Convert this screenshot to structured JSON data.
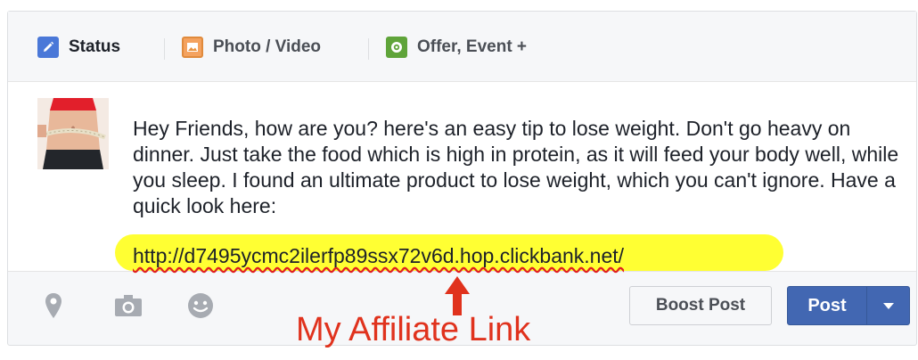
{
  "tabs": [
    {
      "label": "Status",
      "icon": "pencil-icon"
    },
    {
      "label": "Photo / Video",
      "icon": "photo-icon"
    },
    {
      "label": "Offer, Event +",
      "icon": "offer-icon"
    }
  ],
  "post": {
    "text": "Hey Friends, how are you? here's an easy tip to lose weight. Don't go heavy on dinner. Just take the food which is high in protein, as it will feed your body well, while you sleep. I found an ultimate product to lose weight, which you can't ignore. Have a quick look here:",
    "link": "http://d7495ycmc2ilerfp89ssx72v6d.hop.clickbank.net/"
  },
  "footer": {
    "icons": [
      "location-pin-icon",
      "camera-icon",
      "smiley-icon"
    ],
    "boost_label": "Boost Post",
    "post_label": "Post"
  },
  "annotation": {
    "text": "My Affiliate Link"
  },
  "colors": {
    "accent": "#4267b2",
    "highlight": "#ffff33",
    "annotation": "#e0321d"
  }
}
